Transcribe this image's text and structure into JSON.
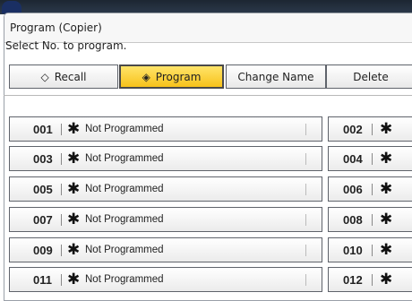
{
  "window": {
    "title": "Program (Copier)",
    "instruction": "Select No. to program."
  },
  "toolbar": {
    "recall_label": "Recall",
    "recall_icon": "◇",
    "program_label": "Program",
    "program_icon": "◈",
    "change_name_label": "Change Name",
    "delete_label": "Delete"
  },
  "colors": {
    "selected_button": "#f7c21a",
    "row_border": "#5f636b"
  },
  "programs": [
    {
      "number": "001",
      "mark": "✱",
      "status": "Not Programmed"
    },
    {
      "number": "002",
      "mark": "✱"
    },
    {
      "number": "003",
      "mark": "✱",
      "status": "Not Programmed"
    },
    {
      "number": "004",
      "mark": "✱"
    },
    {
      "number": "005",
      "mark": "✱",
      "status": "Not Programmed"
    },
    {
      "number": "006",
      "mark": "✱"
    },
    {
      "number": "007",
      "mark": "✱",
      "status": "Not Programmed"
    },
    {
      "number": "008",
      "mark": "✱"
    },
    {
      "number": "009",
      "mark": "✱",
      "status": "Not Programmed"
    },
    {
      "number": "010",
      "mark": "✱"
    },
    {
      "number": "011",
      "mark": "✱",
      "status": "Not Programmed"
    },
    {
      "number": "012",
      "mark": "✱"
    }
  ]
}
